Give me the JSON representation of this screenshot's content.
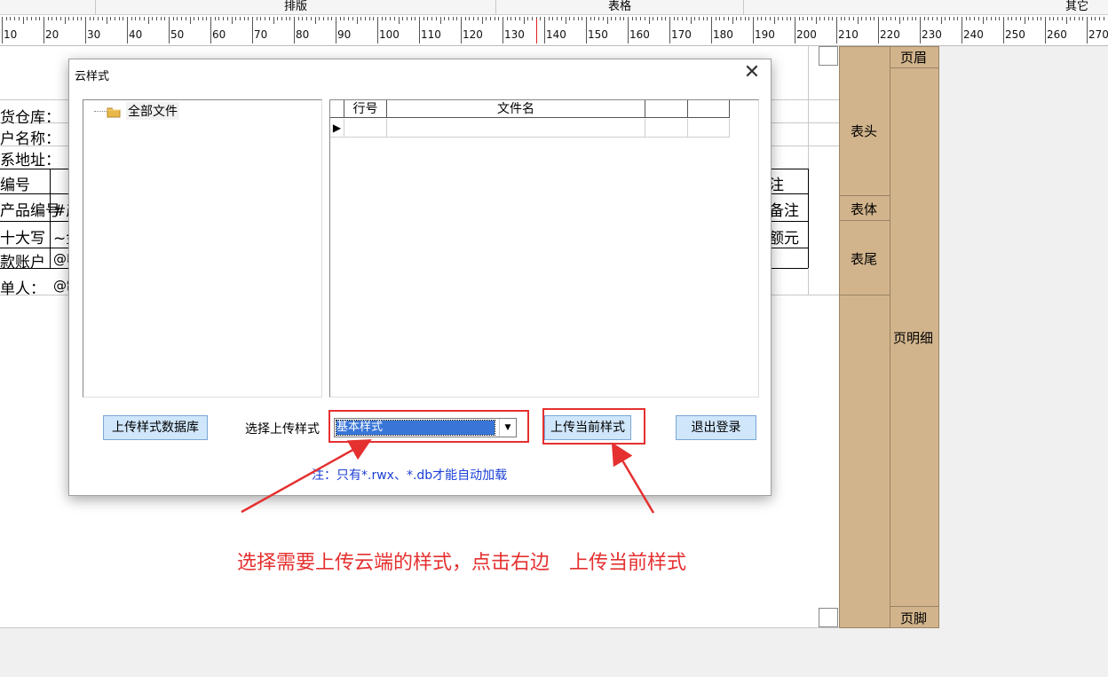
{
  "top_sections": [
    "排版",
    "表格",
    "其它"
  ],
  "ruler": {
    "labels": [
      "10",
      "20",
      "30",
      "40",
      "50",
      "60",
      "70",
      "80",
      "90",
      "100",
      "110",
      "120",
      "130",
      "140",
      "150",
      "160",
      "170",
      "180",
      "190",
      "200",
      "210",
      "220",
      "230",
      "240",
      "250",
      "260",
      "270"
    ]
  },
  "report_bands": {
    "header": "表头",
    "body": "表体",
    "footer": "表尾",
    "page_header": "页眉",
    "page_detail": "页明细",
    "page_footer": "页脚"
  },
  "background_cells": {
    "warehouse": "货仓库：",
    "customer_name": "户名称：",
    "address": "系地址：",
    "code": "编号",
    "product_code": "产品编号",
    "product_code_val": "#产",
    "amount_cn": "十大写",
    "amount_cn_val": "~金",
    "account": "款账户",
    "account_val": "@收",
    "maker": "单人：",
    "maker_val": "@制",
    "remark_header": "注",
    "remark": "备注",
    "amount_yuan": "额元"
  },
  "dialog": {
    "title": "云样式",
    "close_icon": "close-icon",
    "tree": {
      "root_label": "全部文件",
      "icon": "folder-icon"
    },
    "grid": {
      "columns": [
        "行号",
        "文件名",
        "",
        ""
      ],
      "current_row_marker": "▶"
    },
    "buttons": {
      "upload_db": "上传样式数据库",
      "upload_current": "上传当前样式",
      "logout": "退出登录"
    },
    "select": {
      "label": "选择上传样式",
      "value": "基本样式"
    },
    "note": "注：只有*.rwx、*.db才能自动加载"
  },
  "annotation": {
    "text": "选择需要上传云端的样式，点击右边　上传当前样式",
    "color": "#e53030"
  }
}
